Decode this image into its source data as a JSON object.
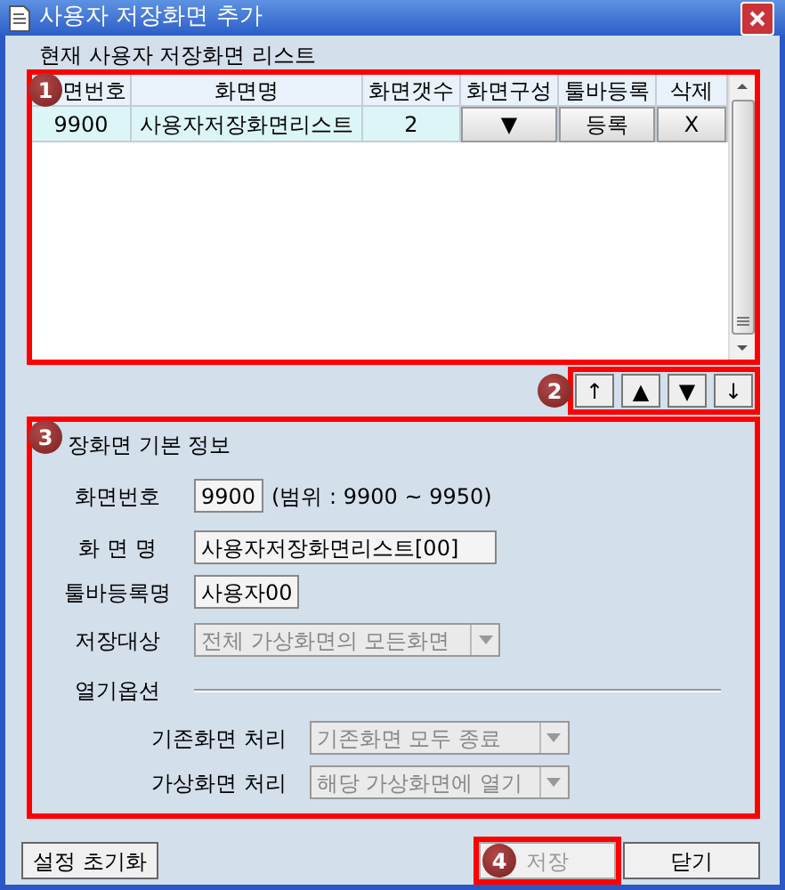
{
  "window": {
    "title": "사용자 저장화면 추가"
  },
  "list": {
    "label": "현재 사용자 저장화면 리스트",
    "columns": [
      "면번호",
      "화면명",
      "화면갯수",
      "화면구성",
      "툴바등록",
      "삭제"
    ],
    "rows": [
      {
        "cells": [
          {
            "kind": "text",
            "text": "9900"
          },
          {
            "kind": "text",
            "text": "사용자저장화면리스트"
          },
          {
            "kind": "text",
            "text": "2"
          },
          {
            "kind": "button",
            "text": "▼"
          },
          {
            "kind": "button",
            "text": "등록"
          },
          {
            "kind": "button",
            "text": "X"
          }
        ]
      }
    ]
  },
  "move_buttons": [
    "↑",
    "▲",
    "▼",
    "↓"
  ],
  "info": {
    "title": "장화면 기본 정보",
    "fields": [
      {
        "kind": "text",
        "label": "화면번호",
        "value": "9900",
        "hint": "(범위 : 9900 ~ 9950)"
      },
      {
        "kind": "text",
        "label": "화 면 명",
        "value": "사용자저장화면리스트[00]"
      },
      {
        "kind": "text",
        "label": "툴바등록명",
        "value": "사용자00"
      },
      {
        "kind": "select",
        "label": "저장대상",
        "value": "전체 가상화면의 모든화면",
        "disabled": true
      }
    ],
    "open_options": {
      "label": "열기옵션",
      "fields": [
        {
          "label": "기존화면 처리",
          "value": "기존화면 모두 종료",
          "disabled": true
        },
        {
          "label": "가상화면 처리",
          "value": "해당 가상화면에 열기",
          "disabled": true
        }
      ]
    }
  },
  "buttons": [
    {
      "label": "설정 초기화",
      "disabled": false
    },
    {
      "label": "저장",
      "disabled": true
    },
    {
      "label": "닫기",
      "disabled": false
    }
  ],
  "annotations": [
    "1",
    "2",
    "3",
    "4"
  ]
}
